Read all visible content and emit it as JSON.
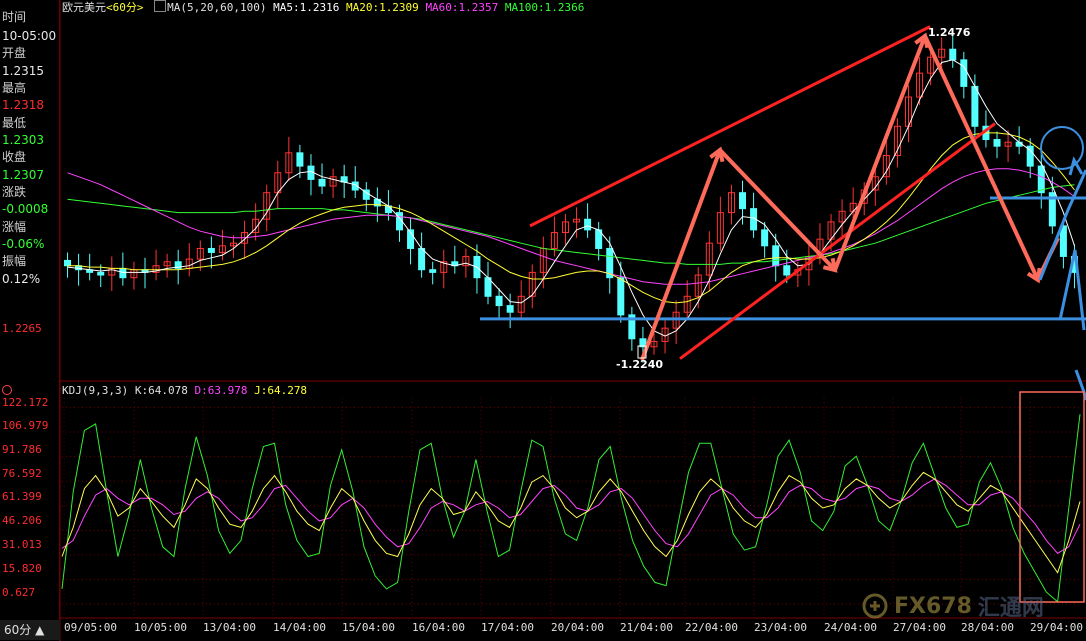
{
  "header": {
    "symbol": "欧元美元",
    "period": "<60分>",
    "ma_label": "MA(5,20,60,100)",
    "ma5": "MA5:1.2316",
    "ma20": "MA20:1.2309",
    "ma60": "MA60:1.2357",
    "ma100": "MA100:1.2366"
  },
  "info_panel": {
    "time_label": "时间",
    "time_value": "10-05:00",
    "open_label": "开盘",
    "open_value": "1.2315",
    "high_label": "最高",
    "high_value": "1.2318",
    "low_label": "最低",
    "low_value": "1.2303",
    "close_label": "收盘",
    "close_value": "1.2307",
    "change_label": "涨跌",
    "change_value": "-0.0008",
    "pct_label": "涨幅",
    "pct_value": "-0.06%",
    "amp_label": "振幅",
    "amp_value": "0.12%"
  },
  "price_axis": {
    "level": "1.2265"
  },
  "annotations": {
    "high": "1.2476",
    "low": "-1.2240"
  },
  "kdj": {
    "label": "KDJ(9,3,3)",
    "k": "K:64.078",
    "d": "D:63.978",
    "j": "J:64.278",
    "y_ticks": [
      "122.172",
      "106.979",
      "91.786",
      "76.592",
      "61.399",
      "46.206",
      "31.013",
      "15.820",
      "0.627"
    ]
  },
  "x_ticks": [
    "09/05:00",
    "10/05:00",
    "13/04:00",
    "14/04:00",
    "15/04:00",
    "16/04:00",
    "17/04:00",
    "20/04:00",
    "21/04:00",
    "22/04:00",
    "23/04:00",
    "24/04:00",
    "27/04:00",
    "28/04:00",
    "29/04:00"
  ],
  "period_tab": "60分 ▲",
  "watermark": {
    "brand": "FX678",
    "suffix": "汇通网"
  },
  "colors": {
    "up": "#ff3333",
    "down": "#54ffff",
    "ma5": "#ffffff",
    "ma20": "#ffff33",
    "ma60": "#ff44ff",
    "ma100": "#33ff33",
    "trend": "#ff2222",
    "arrow": "#ff6b5a",
    "support": "#3d8fe0"
  },
  "chart_data": {
    "type": "candlestick",
    "title": "欧元美元 <60分>",
    "main": {
      "price_range": [
        1.2225,
        1.249
      ],
      "close": [
        1.2305,
        1.2302,
        1.23,
        1.2298,
        1.2303,
        1.2296,
        1.2302,
        1.23,
        1.2305,
        1.2308,
        1.2303,
        1.231,
        1.2318,
        1.2315,
        1.232,
        1.2322,
        1.233,
        1.234,
        1.236,
        1.2375,
        1.239,
        1.238,
        1.237,
        1.2365,
        1.2372,
        1.2368,
        1.2362,
        1.2355,
        1.235,
        1.2345,
        1.2332,
        1.2318,
        1.2302,
        1.23,
        1.2308,
        1.2305,
        1.2312,
        1.2296,
        1.2282,
        1.2275,
        1.227,
        1.2282,
        1.23,
        1.2318,
        1.233,
        1.2338,
        1.234,
        1.2332,
        1.2318,
        1.2296,
        1.2268,
        1.225,
        1.2244,
        1.2248,
        1.2258,
        1.227,
        1.2282,
        1.2298,
        1.2322,
        1.2345,
        1.236,
        1.2348,
        1.2332,
        1.232,
        1.2305,
        1.2298,
        1.2302,
        1.2312,
        1.2325,
        1.2338,
        1.2346,
        1.2352,
        1.2362,
        1.2372,
        1.2388,
        1.241,
        1.2432,
        1.245,
        1.2462,
        1.2468,
        1.246,
        1.244,
        1.241,
        1.24,
        1.2395,
        1.2398,
        1.2395,
        1.238,
        1.236,
        1.2335,
        1.2312,
        1.23
      ],
      "ma5": [
        1.2304,
        1.2303,
        1.2302,
        1.2301,
        1.2302,
        1.23,
        1.23,
        1.23,
        1.2301,
        1.2303,
        1.2304,
        1.2305,
        1.2309,
        1.2311,
        1.2313,
        1.2318,
        1.2325,
        1.2333,
        1.2345,
        1.236,
        1.237,
        1.2375,
        1.2376,
        1.2372,
        1.237,
        1.2368,
        1.2366,
        1.236,
        1.2355,
        1.235,
        1.2341,
        1.233,
        1.2318,
        1.231,
        1.2307,
        1.2305,
        1.2307,
        1.2304,
        1.2296,
        1.2287,
        1.2278,
        1.2277,
        1.2283,
        1.2295,
        1.2308,
        1.232,
        1.2332,
        1.2335,
        1.2332,
        1.2322,
        1.2304,
        1.2285,
        1.2268,
        1.2256,
        1.2252,
        1.2256,
        1.2265,
        1.2278,
        1.2294,
        1.2314,
        1.2332,
        1.2342,
        1.2341,
        1.2336,
        1.2325,
        1.2312,
        1.2305,
        1.2306,
        1.2314,
        1.2325,
        1.2336,
        1.2346,
        1.2355,
        1.2364,
        1.2376,
        1.2392,
        1.241,
        1.243,
        1.2446,
        1.2458,
        1.246,
        1.2455,
        1.244,
        1.2425,
        1.2412,
        1.2405,
        1.2398,
        1.2392,
        1.2382,
        1.2365,
        1.2345,
        1.232
      ],
      "ma20": [
        1.2305,
        1.2305,
        1.2304,
        1.2304,
        1.2303,
        1.2303,
        1.2302,
        1.2302,
        1.2302,
        1.2302,
        1.2302,
        1.2303,
        1.2304,
        1.2305,
        1.2306,
        1.2308,
        1.2311,
        1.2315,
        1.232,
        1.2326,
        1.2332,
        1.2337,
        1.2341,
        1.2344,
        1.2347,
        1.2349,
        1.235,
        1.2351,
        1.2351,
        1.235,
        1.2348,
        1.2345,
        1.2341,
        1.2336,
        1.2331,
        1.2326,
        1.2321,
        1.2316,
        1.231,
        1.2305,
        1.23,
        1.2297,
        1.2295,
        1.2295,
        1.2296,
        1.2298,
        1.23,
        1.2301,
        1.2301,
        1.2299,
        1.2295,
        1.229,
        1.2285,
        1.2281,
        1.2278,
        1.2277,
        1.2278,
        1.2281,
        1.2286,
        1.2293,
        1.23,
        1.2305,
        1.2308,
        1.231,
        1.2311,
        1.2311,
        1.231,
        1.231,
        1.2311,
        1.2313,
        1.2316,
        1.232,
        1.2325,
        1.2331,
        1.2338,
        1.2346,
        1.2356,
        1.2367,
        1.2378,
        1.2388,
        1.2396,
        1.2401,
        1.2404,
        1.2405,
        1.2405,
        1.2404,
        1.2402,
        1.2398,
        1.2392,
        1.2383,
        1.2373,
        1.2362
      ],
      "ma60": [
        1.2375,
        1.2372,
        1.2369,
        1.2366,
        1.2362,
        1.2358,
        1.2354,
        1.235,
        1.2346,
        1.2342,
        1.2338,
        1.2334,
        1.2331,
        1.2329,
        1.2327,
        1.2326,
        1.2326,
        1.2327,
        1.2328,
        1.233,
        1.2332,
        1.2334,
        1.2336,
        1.2338,
        1.234,
        1.2341,
        1.2342,
        1.2343,
        1.2343,
        1.2343,
        1.2342,
        1.2341,
        1.2339,
        1.2337,
        1.2335,
        1.2333,
        1.2331,
        1.2329,
        1.2327,
        1.2324,
        1.2321,
        1.2318,
        1.2315,
        1.2312,
        1.2309,
        1.2307,
        1.2305,
        1.2303,
        1.2301,
        1.2299,
        1.2297,
        1.2295,
        1.2293,
        1.2292,
        1.2291,
        1.2291,
        1.2291,
        1.2292,
        1.2293,
        1.2295,
        1.2297,
        1.2299,
        1.2301,
        1.2303,
        1.2305,
        1.2307,
        1.2309,
        1.2311,
        1.2313,
        1.2315,
        1.2318,
        1.2321,
        1.2325,
        1.2329,
        1.2334,
        1.2339,
        1.2345,
        1.2351,
        1.2357,
        1.2363,
        1.2368,
        1.2372,
        1.2375,
        1.2377,
        1.2378,
        1.2378,
        1.2377,
        1.2375,
        1.2372,
        1.2368,
        1.2363,
        1.2357
      ],
      "ma100": [
        1.2355,
        1.2354,
        1.2353,
        1.2352,
        1.2351,
        1.235,
        1.2349,
        1.2348,
        1.2347,
        1.2346,
        1.2345,
        1.2345,
        1.2345,
        1.2345,
        1.2345,
        1.2345,
        1.2346,
        1.2346,
        1.2347,
        1.2348,
        1.2348,
        1.2348,
        1.2348,
        1.2348,
        1.2347,
        1.2347,
        1.2346,
        1.2345,
        1.2344,
        1.2343,
        1.2342,
        1.2341,
        1.234,
        1.2338,
        1.2336,
        1.2334,
        1.2332,
        1.233,
        1.2328,
        1.2326,
        1.2324,
        1.2322,
        1.232,
        1.2318,
        1.2317,
        1.2316,
        1.2315,
        1.2314,
        1.2313,
        1.2312,
        1.2311,
        1.231,
        1.2309,
        1.2308,
        1.2307,
        1.2307,
        1.2306,
        1.2306,
        1.2306,
        1.2306,
        1.2307,
        1.2307,
        1.2308,
        1.2308,
        1.2309,
        1.231,
        1.2311,
        1.2312,
        1.2313,
        1.2314,
        1.2316,
        1.2318,
        1.232,
        1.2322,
        1.2325,
        1.2328,
        1.2331,
        1.2334,
        1.2337,
        1.234,
        1.2343,
        1.2346,
        1.2349,
        1.2352,
        1.2354,
        1.2356,
        1.2358,
        1.236,
        1.2362,
        1.2364,
        1.2365,
        1.2366
      ]
    },
    "kdj_panel": {
      "y_range": [
        -8,
        128
      ],
      "k": [
        30,
        48,
        72,
        80,
        70,
        55,
        60,
        72,
        64,
        55,
        48,
        62,
        78,
        72,
        60,
        50,
        48,
        58,
        72,
        80,
        70,
        58,
        50,
        46,
        60,
        72,
        66,
        52,
        40,
        32,
        30,
        44,
        62,
        72,
        66,
        56,
        58,
        70,
        62,
        52,
        48,
        60,
        76,
        80,
        72,
        60,
        54,
        58,
        70,
        78,
        70,
        58,
        46,
        36,
        30,
        40,
        56,
        70,
        78,
        72,
        60,
        52,
        48,
        56,
        70,
        80,
        76,
        66,
        60,
        62,
        72,
        78,
        74,
        66,
        60,
        64,
        74,
        82,
        78,
        70,
        62,
        58,
        66,
        74,
        70,
        60,
        50,
        40,
        30,
        20,
        40,
        64
      ],
      "d": [
        35,
        40,
        55,
        68,
        72,
        66,
        62,
        66,
        66,
        62,
        56,
        58,
        66,
        70,
        66,
        58,
        52,
        54,
        62,
        72,
        74,
        66,
        58,
        52,
        54,
        62,
        66,
        60,
        50,
        42,
        36,
        38,
        48,
        60,
        64,
        62,
        58,
        62,
        64,
        60,
        54,
        56,
        64,
        72,
        74,
        68,
        60,
        58,
        62,
        70,
        72,
        66,
        56,
        46,
        38,
        36,
        44,
        56,
        68,
        72,
        68,
        60,
        54,
        54,
        60,
        70,
        74,
        72,
        66,
        64,
        66,
        72,
        74,
        72,
        66,
        64,
        68,
        74,
        78,
        74,
        68,
        62,
        62,
        68,
        70,
        66,
        58,
        50,
        40,
        32,
        36,
        50
      ],
      "j": [
        10,
        70,
        108,
        112,
        70,
        30,
        56,
        90,
        60,
        36,
        30,
        72,
        104,
        80,
        46,
        32,
        40,
        72,
        98,
        100,
        62,
        40,
        30,
        32,
        74,
        96,
        70,
        36,
        18,
        10,
        14,
        58,
        96,
        100,
        66,
        42,
        58,
        90,
        58,
        30,
        34,
        70,
        102,
        98,
        66,
        44,
        40,
        60,
        90,
        98,
        66,
        40,
        24,
        14,
        12,
        48,
        82,
        100,
        100,
        72,
        44,
        34,
        36,
        62,
        92,
        102,
        82,
        52,
        46,
        58,
        86,
        92,
        74,
        52,
        46,
        64,
        88,
        100,
        80,
        60,
        48,
        50,
        76,
        88,
        72,
        48,
        32,
        20,
        8,
        2,
        60,
        118
      ]
    },
    "annotations": {
      "period_high": 1.2476,
      "period_low": 1.224,
      "support": 1.2265
    }
  }
}
